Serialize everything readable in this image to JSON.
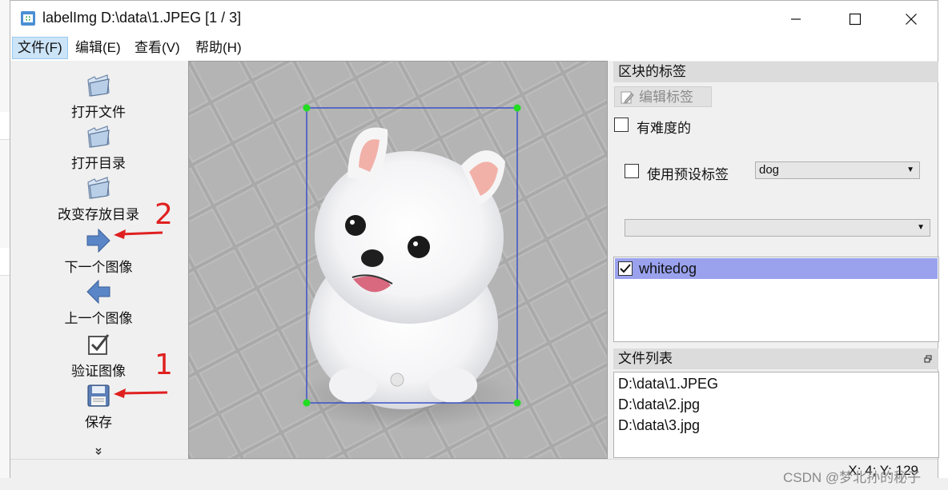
{
  "window": {
    "title": "labelImg D:\\data\\1.JPEG [1 / 3]",
    "app_icon": "labelimg-app-icon",
    "controls": [
      "minimize-icon",
      "maximize-icon",
      "close-icon"
    ]
  },
  "menu": [
    {
      "label": "文件(F)",
      "active": true
    },
    {
      "label": "编辑(E)"
    },
    {
      "label": "查看(V)"
    },
    {
      "label": "帮助(H)"
    }
  ],
  "toolbar": {
    "items": [
      {
        "label": "打开文件",
        "icon": "folder-open-icon"
      },
      {
        "label": "打开目录",
        "icon": "folder-open-icon"
      },
      {
        "label": "改变存放目录",
        "icon": "folder-open-icon"
      },
      {
        "label": "下一个图像",
        "icon": "arrow-right-icon"
      },
      {
        "label": "上一个图像",
        "icon": "arrow-left-icon"
      },
      {
        "label": "验证图像",
        "icon": "checkbox-checked-icon"
      },
      {
        "label": "保存",
        "icon": "floppy-disk-icon"
      }
    ],
    "more_icon": "chevron-double-down-icon"
  },
  "annotations": {
    "marker_1": "1",
    "marker_2": "2",
    "arrow_color": "#e02020"
  },
  "canvas": {
    "image_description_icon": "white-pomeranian-dog-photo",
    "bbox_color": "#3a52c8",
    "vertex_color": "#22dd22"
  },
  "box_labels_panel": {
    "title": "区块的标签",
    "edit_label_button": "编辑标签",
    "difficult_label": "有难度的",
    "use_default_label": "使用预设标签",
    "default_label_value": "dog",
    "second_combo_value": "",
    "labels": [
      {
        "text": "whitedog",
        "checked": true
      }
    ]
  },
  "file_list_panel": {
    "title": "文件列表",
    "float_icon": "dock-float-icon",
    "files": [
      "D:\\data\\1.JPEG",
      "D:\\data\\2.jpg",
      "D:\\data\\3.jpg"
    ]
  },
  "status": {
    "coords": "X: 4; Y: 129"
  },
  "watermark": "CSDN @梦北孙的秘子",
  "colors": {
    "selected_row": "#9aa2ee",
    "menu_active": "#cce4f7",
    "dock_title_bg": "#dcdcdc"
  }
}
